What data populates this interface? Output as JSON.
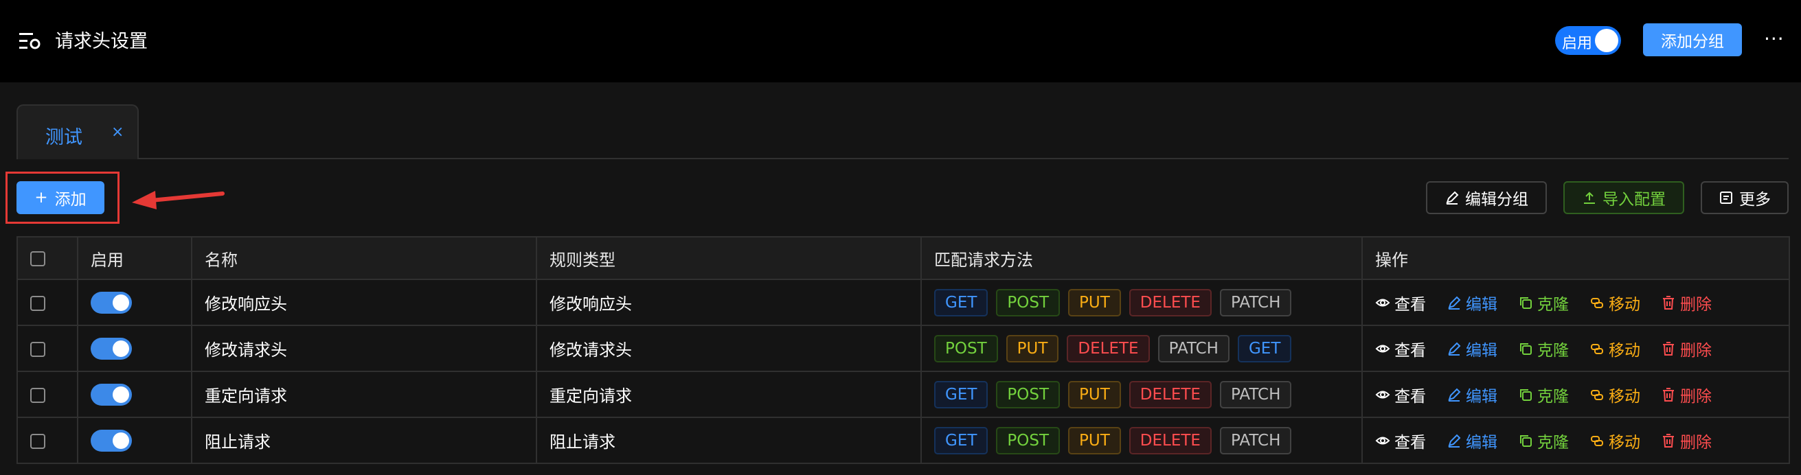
{
  "header": {
    "title": "请求头设置",
    "enable_label": "启用",
    "add_group_label": "添加分组",
    "more_label": "···"
  },
  "tabs": [
    {
      "label": "测试",
      "close": "×"
    }
  ],
  "toolbar": {
    "add_label": "添加",
    "add_plus": "+",
    "edit_group_label": "编辑分组",
    "import_label": "导入配置",
    "more_label": "更多"
  },
  "table": {
    "columns": [
      "启用",
      "名称",
      "规则类型",
      "匹配请求方法",
      "操作"
    ],
    "rows": [
      {
        "enabled": true,
        "name": "修改响应头",
        "type": "修改响应头",
        "methods": [
          "GET",
          "POST",
          "PUT",
          "DELETE",
          "PATCH"
        ]
      },
      {
        "enabled": true,
        "name": "修改请求头",
        "type": "修改请求头",
        "methods": [
          "POST",
          "PUT",
          "DELETE",
          "PATCH",
          "GET"
        ]
      },
      {
        "enabled": true,
        "name": "重定向请求",
        "type": "重定向请求",
        "methods": [
          "GET",
          "POST",
          "PUT",
          "DELETE",
          "PATCH"
        ]
      },
      {
        "enabled": true,
        "name": "阻止请求",
        "type": "阻止请求",
        "methods": [
          "GET",
          "POST",
          "PUT",
          "DELETE",
          "PATCH"
        ]
      }
    ],
    "actions": [
      {
        "label": "查看",
        "icon": "eye-icon",
        "color": "#ffffff"
      },
      {
        "label": "编辑",
        "icon": "pencil-icon",
        "color": "#4096ff"
      },
      {
        "label": "克隆",
        "icon": "copy-icon",
        "color": "#73d13d"
      },
      {
        "label": "移动",
        "icon": "move-icon",
        "color": "#faad14"
      },
      {
        "label": "删除",
        "icon": "trash-icon",
        "color": "#ff4d4f"
      }
    ]
  },
  "method_colors": {
    "GET": {
      "fg": "#4096ff",
      "bg": "#111a2c",
      "border": "#15325b"
    },
    "POST": {
      "fg": "#73d13d",
      "bg": "#162312",
      "border": "#274916"
    },
    "PUT": {
      "fg": "#faad14",
      "bg": "#2b2111",
      "border": "#594214"
    },
    "DELETE": {
      "fg": "#ff4d4f",
      "bg": "#2c1618",
      "border": "#5b2526"
    },
    "PATCH": {
      "fg": "#bfbfbf",
      "bg": "#1f1f1f",
      "border": "#424242"
    }
  }
}
